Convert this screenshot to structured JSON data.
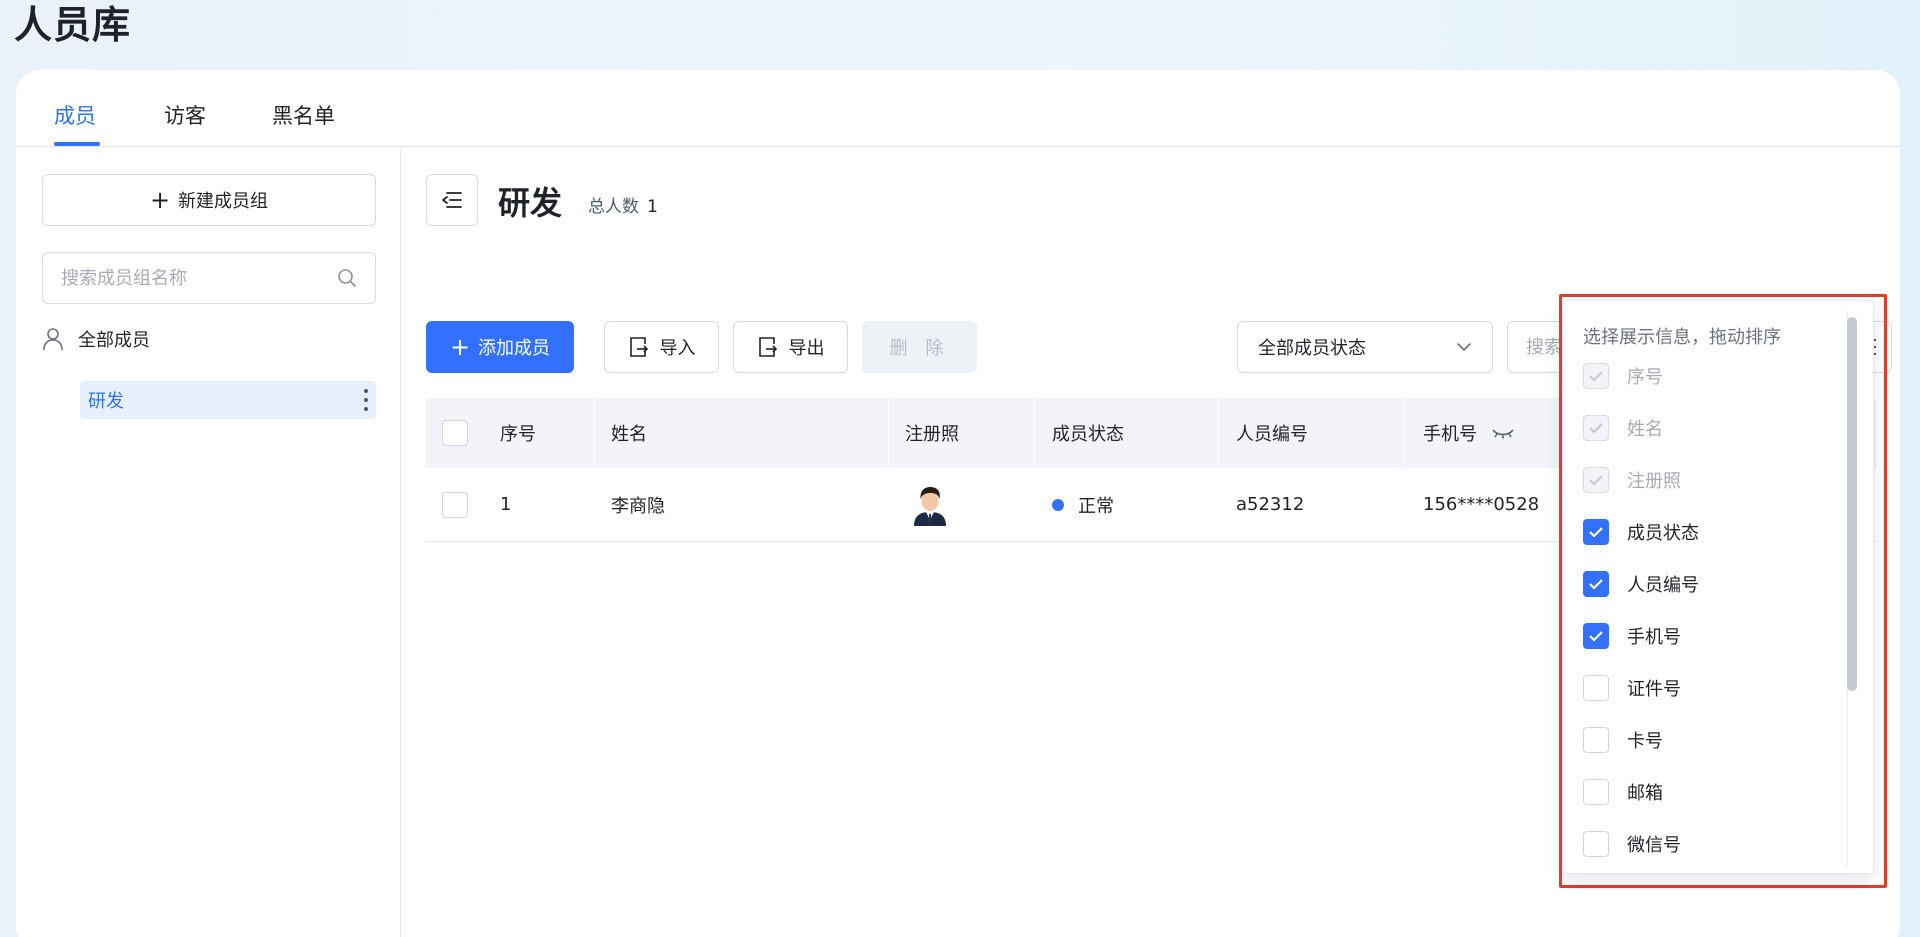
{
  "page": {
    "title": "人员库"
  },
  "tabs": [
    {
      "label": "成员",
      "active": true
    },
    {
      "label": "访客",
      "active": false
    },
    {
      "label": "黑名单",
      "active": false
    }
  ],
  "sidebar": {
    "new_group_label": "新建成员组",
    "search_placeholder": "搜索成员组名称",
    "all_members_label": "全部成员",
    "groups": [
      {
        "label": "研发",
        "selected": true
      }
    ]
  },
  "main": {
    "group_title": "研发",
    "total_label": "总人数",
    "total_count": "1",
    "toolbar": {
      "add_label": "添加成员",
      "import_label": "导入",
      "export_label": "导出",
      "delete_label": "删 除",
      "status_select": "全部成员状态",
      "search_placeholder": "搜索姓名/编号"
    },
    "table": {
      "headers": [
        "序号",
        "姓名",
        "注册照",
        "成员状态",
        "人员编号",
        "手机号"
      ],
      "rows": [
        {
          "index": "1",
          "name": "李商隐",
          "status": "正常",
          "employee_id": "a52312",
          "phone": "156****0528"
        }
      ]
    }
  },
  "column_picker": {
    "title": "选择展示信息，拖动排序",
    "options": [
      {
        "label": "序号",
        "state": "locked"
      },
      {
        "label": "姓名",
        "state": "locked"
      },
      {
        "label": "注册照",
        "state": "locked"
      },
      {
        "label": "成员状态",
        "state": "checked"
      },
      {
        "label": "人员编号",
        "state": "checked"
      },
      {
        "label": "手机号",
        "state": "checked"
      },
      {
        "label": "证件号",
        "state": "unchecked"
      },
      {
        "label": "卡号",
        "state": "unchecked"
      },
      {
        "label": "邮箱",
        "state": "unchecked"
      },
      {
        "label": "微信号",
        "state": "unchecked"
      }
    ]
  },
  "colors": {
    "accent": "#3370ff",
    "highlight": "#e23b2e",
    "status_normal": "#3370ff"
  }
}
